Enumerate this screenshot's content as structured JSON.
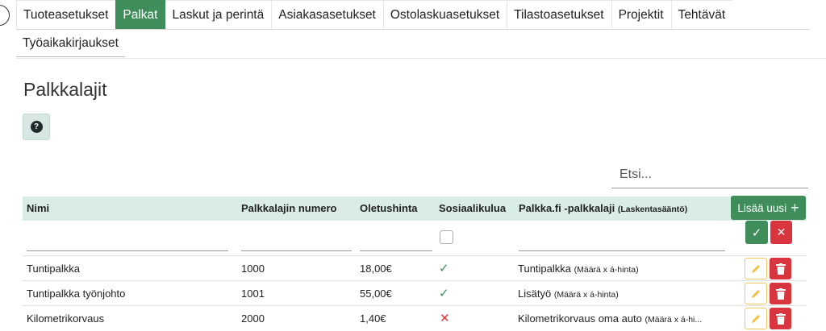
{
  "tabs": {
    "row1": [
      "Tuoteasetukset",
      "Palkat",
      "Laskut ja perintä",
      "Asiakasasetukset",
      "Ostolaskuasetukset",
      "Tilastoasetukset",
      "Projektit",
      "Tehtävät"
    ],
    "row2": [
      "Työaikakirjaukset"
    ],
    "active": "Palkat"
  },
  "page": {
    "title": "Palkkalajit",
    "help": "?"
  },
  "search": {
    "placeholder": "Etsi..."
  },
  "table": {
    "headers": {
      "name": "Nimi",
      "number": "Palkkalajin numero",
      "price": "Oletushinta",
      "social": "Sosiaalikulua",
      "palkka": "Palkka.fi -palkkalaji",
      "palkka_note": "(Laskentasääntö)"
    },
    "add_label": "Lisää uusi",
    "rows": [
      {
        "name": "Tuntipalkka",
        "number": "1000",
        "price": "18,00€",
        "social": true,
        "palkka": "Tuntipalkka",
        "rule": "(Määrä x á-hinta)"
      },
      {
        "name": "Tuntipalkka työnjohto",
        "number": "1001",
        "price": "55,00€",
        "social": true,
        "palkka": "Lisätyö",
        "rule": "(Määrä x á-hinta)"
      },
      {
        "name": "Kilometrikorvaus",
        "number": "2000",
        "price": "1,40€",
        "social": false,
        "palkka": "Kilometrikorvaus oma auto",
        "rule": "(Määrä x á-hi..."
      }
    ]
  },
  "colors": {
    "accent": "#3f8d5b",
    "danger": "#d9353e",
    "header_bg": "#d9ede6",
    "edit_border": "#f0c75e"
  }
}
